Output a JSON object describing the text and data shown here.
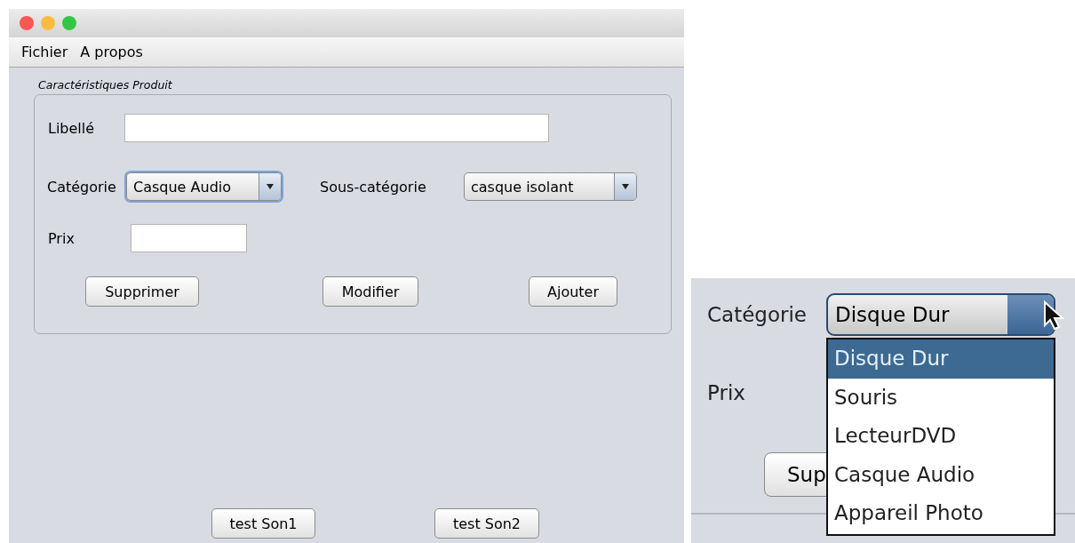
{
  "window": {
    "menu": [
      "Fichier",
      "A propos"
    ],
    "group_title": "Caractéristiques Produit",
    "libelle": {
      "label": "Libellé"
    },
    "categorie": {
      "label": "Catégorie",
      "value": "Casque Audio",
      "focused": true
    },
    "sous_categorie": {
      "label": "Sous-catégorie",
      "value": "casque isolant",
      "focused": false
    },
    "prix": {
      "label": "Prix"
    },
    "buttons": [
      "Supprimer",
      "Modifier",
      "Ajouter"
    ],
    "bottom_buttons": [
      "test Son1",
      "test Son2"
    ]
  },
  "inset": {
    "categorie_label": "Catégorie",
    "combo_value": "Disque Dur",
    "prix_label": "Prix",
    "partial_button": "Sup",
    "options": [
      {
        "label": "Disque Dur",
        "selected": true
      },
      {
        "label": "Souris",
        "selected": false
      },
      {
        "label": "LecteurDVD",
        "selected": false
      },
      {
        "label": "Casque Audio",
        "selected": false
      },
      {
        "label": "Appareil Photo",
        "selected": false
      }
    ]
  }
}
